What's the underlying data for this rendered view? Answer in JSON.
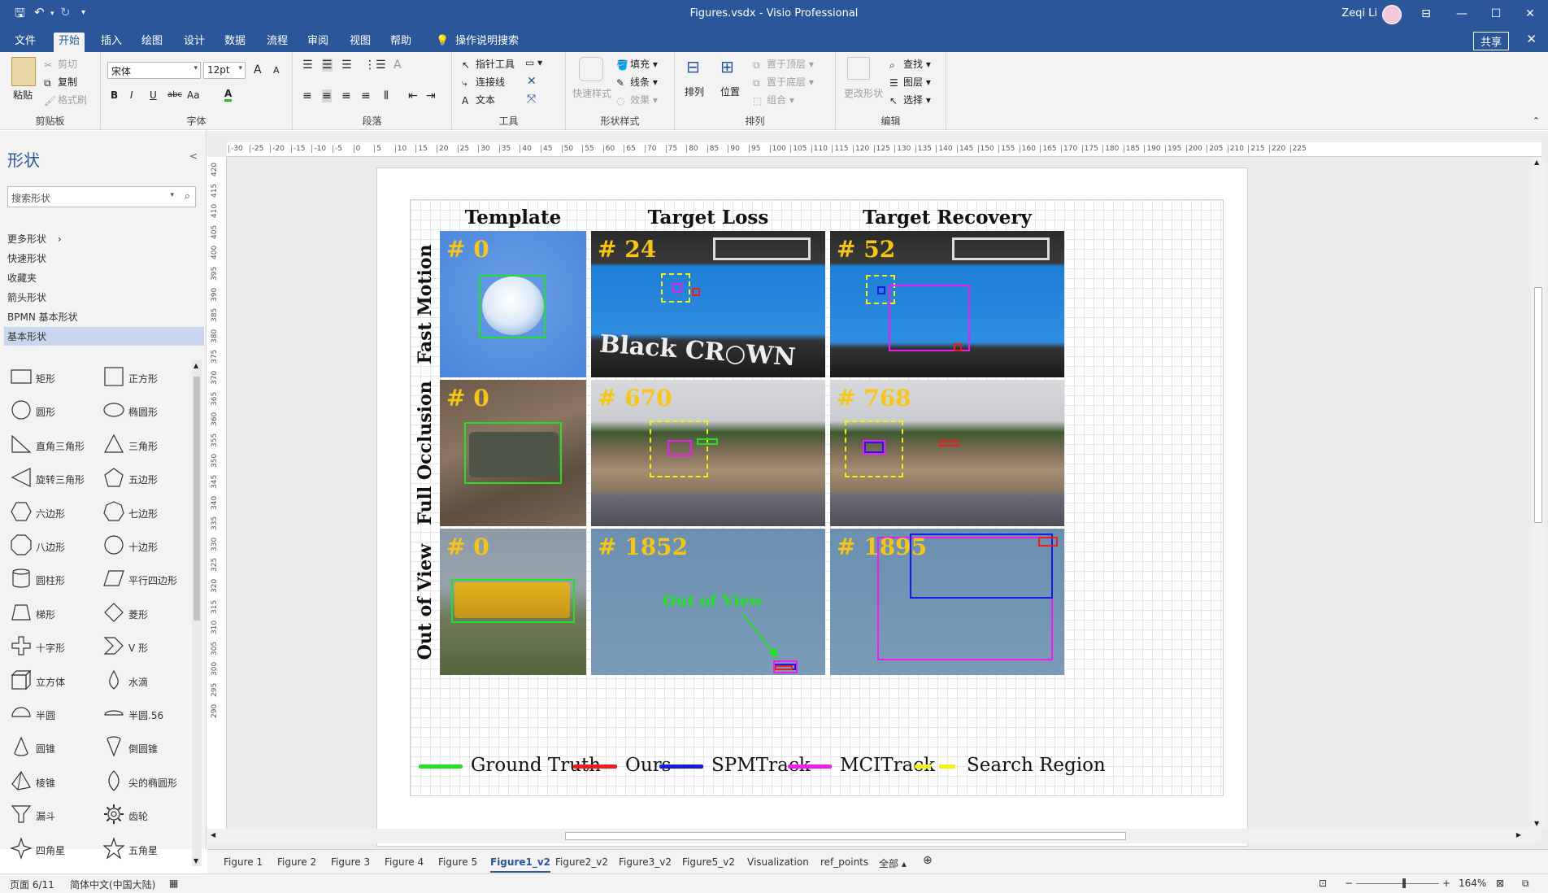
{
  "window": {
    "title": "Figures.vsdx  -  Visio Professional",
    "user": "Zeqi Li",
    "minimize": "—",
    "maximize": "☐",
    "close": "✕",
    "ribbon_display": "⊟"
  },
  "tabs": [
    "文件",
    "开始",
    "插入",
    "绘图",
    "设计",
    "数据",
    "流程",
    "审阅",
    "视图",
    "帮助"
  ],
  "tell_me": "操作说明搜索",
  "share": "共享",
  "ribbon": {
    "clipboard": {
      "label": "剪贴板",
      "paste": "粘贴",
      "cut": "剪切",
      "copy": "复制",
      "format_painter": "格式刷"
    },
    "font": {
      "label": "字体",
      "font_name": "宋体",
      "font_size": "12pt",
      "bold": "B",
      "italic": "I",
      "underline": "U",
      "strike": "abc",
      "case": "Aa",
      "grow": "A",
      "shrink": "A"
    },
    "paragraph": {
      "label": "段落"
    },
    "tools": {
      "label": "工具",
      "pointer": "指针工具",
      "connector": "连接线",
      "text": "文本"
    },
    "shape_styles": {
      "label": "形状样式",
      "quick_styles": "快速样式",
      "fill": "填充",
      "line": "线条",
      "effects": "效果"
    },
    "arrange": {
      "label": "排列",
      "arrange": "排列",
      "position": "位置",
      "bring_front": "置于顶层",
      "send_back": "置于底层",
      "group": "组合"
    },
    "editing": {
      "label": "编辑",
      "change_shape": "更改形状",
      "find": "查找",
      "layers": "图层",
      "select": "选择"
    }
  },
  "shapes_panel": {
    "title": "形状",
    "search_placeholder": "搜索形状",
    "stencils": [
      "更多形状",
      "快速形状",
      "收藏夹",
      "箭头形状",
      "BPMN 基本形状",
      "基本形状"
    ],
    "selected_stencil": "基本形状",
    "items": [
      [
        "矩形",
        "正方形"
      ],
      [
        "圆形",
        "椭圆形"
      ],
      [
        "直角三角形",
        "三角形"
      ],
      [
        "旋转三角形",
        "五边形"
      ],
      [
        "六边形",
        "七边形"
      ],
      [
        "八边形",
        "十边形"
      ],
      [
        "圆柱形",
        "平行四边形"
      ],
      [
        "梯形",
        "菱形"
      ],
      [
        "十字形",
        "V 形"
      ],
      [
        "立方体",
        "水滴"
      ],
      [
        "半圆",
        "半圆.56"
      ],
      [
        "圆锥",
        "倒圆锥"
      ],
      [
        "棱锥",
        "尖的椭圆形"
      ],
      [
        "漏斗",
        "齿轮"
      ],
      [
        "四角星",
        "五角星"
      ]
    ]
  },
  "ruler": {
    "h": [
      "-30",
      "-25",
      "-20",
      "-15",
      "-10",
      "-5",
      "0",
      "5",
      "10",
      "15",
      "20",
      "25",
      "30",
      "35",
      "40",
      "45",
      "50",
      "55",
      "60",
      "65",
      "70",
      "75",
      "80",
      "85",
      "90",
      "95",
      "100",
      "105",
      "110",
      "115",
      "120",
      "125",
      "130",
      "135",
      "140",
      "145",
      "150",
      "155",
      "160",
      "165",
      "170",
      "175",
      "180",
      "185",
      "190",
      "195",
      "200",
      "205",
      "210",
      "215",
      "220",
      "225"
    ],
    "v": [
      "420",
      "415",
      "410",
      "405",
      "400",
      "395",
      "390",
      "385",
      "380",
      "375",
      "370",
      "365",
      "360",
      "355",
      "350",
      "345",
      "340",
      "335",
      "330",
      "325",
      "320",
      "315",
      "310",
      "305",
      "300",
      "295",
      "290"
    ]
  },
  "figure": {
    "columns": [
      "Template",
      "Target Loss",
      "Target Recovery"
    ],
    "rows": [
      {
        "label": "Fast Motion",
        "frames": [
          "# 0",
          "# 24",
          "# 52"
        ]
      },
      {
        "label": "Full Occlusion",
        "frames": [
          "# 0",
          "# 670",
          "# 768"
        ]
      },
      {
        "label": "Out of View",
        "frames": [
          "# 0",
          "# 1852",
          "# 1895"
        ]
      }
    ],
    "annotation": "Out of View",
    "legend": [
      {
        "name": "Ground Truth",
        "color": "#22e022"
      },
      {
        "name": "Ours",
        "color": "#ee1c1c"
      },
      {
        "name": "SPMTrack",
        "color": "#1a1ae6"
      },
      {
        "name": "MCITrack",
        "color": "#ee1cee"
      },
      {
        "name": "Search Region",
        "color": "#f2f20a"
      }
    ]
  },
  "sheets": [
    "Figure 1",
    "Figure 2",
    "Figure 3",
    "Figure 4",
    "Figure 5",
    "Figure1_v2",
    "Figure2_v2",
    "Figure3_v2",
    "Figure5_v2",
    "Visualization",
    "ref_points",
    "全部"
  ],
  "active_sheet": "Figure1_v2",
  "status": {
    "page": "页面 6/11",
    "language": "简体中文(中国大陆)",
    "zoom": "164%"
  }
}
